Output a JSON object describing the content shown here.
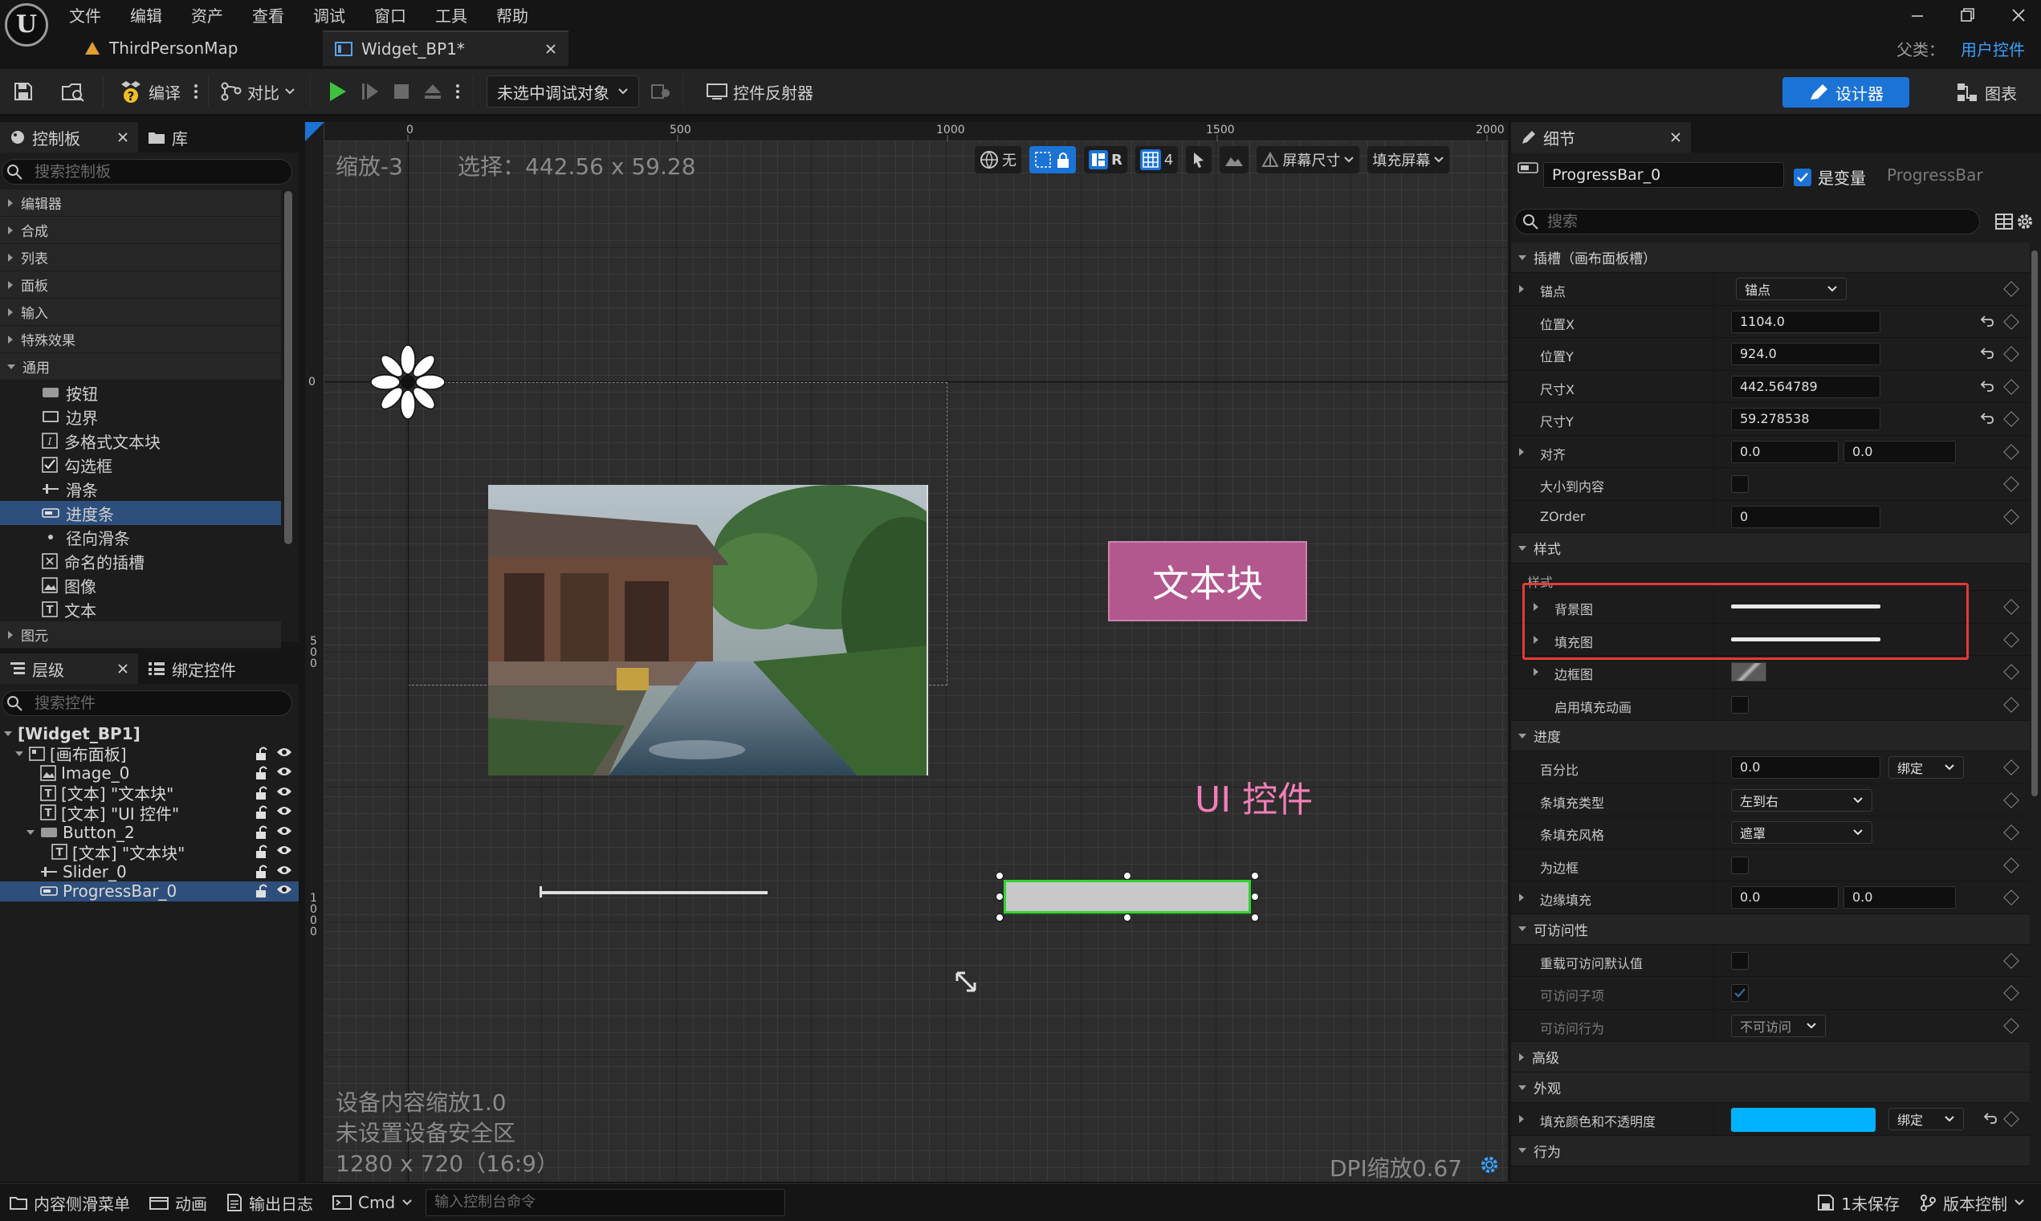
{
  "menu": {
    "logo": "U",
    "items": [
      "文件",
      "编辑",
      "资产",
      "查看",
      "调试",
      "窗口",
      "工具",
      "帮助"
    ]
  },
  "doc_tabs": [
    {
      "label": "ThirdPersonMap"
    },
    {
      "label": "Widget_BP1*"
    }
  ],
  "parent": {
    "label": "父类：",
    "value": "用户控件"
  },
  "toolbar": {
    "compile": "编译",
    "diff": "对比",
    "debug_target": "未选中调试对象",
    "reflector": "控件反射器",
    "designer": "设计器",
    "graph": "图表"
  },
  "palette": {
    "tabs": [
      "控制板",
      "库"
    ],
    "search_placeholder": "搜索控制板",
    "categories": [
      "编辑器",
      "合成",
      "列表",
      "面板",
      "输入",
      "特殊效果",
      "通用"
    ],
    "items": [
      "按钮",
      "边界",
      "多格式文本块",
      "勾选框",
      "滑条",
      "进度条",
      "径向滑条",
      "命名的插槽",
      "图像",
      "文本"
    ],
    "selected_item": "进度条",
    "bottom_category": "图元"
  },
  "hierarchy": {
    "tabs": [
      "层级",
      "绑定控件"
    ],
    "search_placeholder": "搜索控件",
    "items": [
      {
        "label": "[Widget_BP1]",
        "indent": 0,
        "icon": "none",
        "bold": true,
        "expanded": true
      },
      {
        "label": "[画布面板]",
        "indent": 1,
        "icon": "canvas",
        "expanded": true
      },
      {
        "label": "Image_0",
        "indent": 2,
        "icon": "image"
      },
      {
        "label": "[文本] \"文本块\"",
        "indent": 2,
        "icon": "text"
      },
      {
        "label": "[文本] \"UI 控件\"",
        "indent": 2,
        "icon": "text"
      },
      {
        "label": "Button_2",
        "indent": 2,
        "icon": "button",
        "expanded": true
      },
      {
        "label": "[文本] \"文本块\"",
        "indent": 3,
        "icon": "text"
      },
      {
        "label": "Slider_0",
        "indent": 2,
        "icon": "slider"
      },
      {
        "label": "ProgressBar_0",
        "indent": 2,
        "icon": "progress",
        "selected": true
      }
    ]
  },
  "canvas": {
    "zoom": "缩放-3",
    "selection": "选择：442.56 x 59.28",
    "ruler_top": [
      "0",
      "500",
      "1000",
      "1500",
      "2000"
    ],
    "ruler_left": [
      "0",
      "5\n0\n0",
      "1\n0\n0\n0"
    ],
    "tb_none": "无",
    "tb_r": "R",
    "tb_grid": "4",
    "tb_screen_size": "屏幕尺寸",
    "tb_fill_screen": "填充屏幕",
    "textblock": "文本块",
    "ui_label": "UI 控件",
    "device_scale": "设备内容缩放1.0",
    "safe_zone": "未设置设备安全区",
    "resolution": "1280 x 720（16:9）",
    "dpi": "DPI缩放0.67"
  },
  "details": {
    "tab": "细节",
    "name": "ProgressBar_0",
    "is_variable": "是变量",
    "class": "ProgressBar",
    "search_placeholder": "搜索",
    "rows": [
      {
        "type": "section",
        "label": "插槽（画布面板槽）"
      },
      {
        "type": "select",
        "label": "锚点",
        "value": "锚点",
        "arrow": true
      },
      {
        "type": "input",
        "label": "位置X",
        "value": "1104.0",
        "reset": true
      },
      {
        "type": "input",
        "label": "位置Y",
        "value": "924.0",
        "reset": true
      },
      {
        "type": "input",
        "label": "尺寸X",
        "value": "442.564789",
        "reset": true
      },
      {
        "type": "input",
        "label": "尺寸Y",
        "value": "59.278538",
        "reset": true
      },
      {
        "type": "pair",
        "label": "对齐",
        "v1": "0.0",
        "v2": "0.0",
        "arrow": true
      },
      {
        "type": "check",
        "label": "大小到内容"
      },
      {
        "type": "input",
        "label": "ZOrder",
        "value": "0"
      },
      {
        "type": "section",
        "label": "样式"
      },
      {
        "type": "subsection",
        "label": "样式"
      },
      {
        "type": "brush",
        "label": "背景图",
        "arrow": true
      },
      {
        "type": "brush",
        "label": "填充图",
        "arrow": true
      },
      {
        "type": "swatch",
        "label": "边框图",
        "arrow": true
      },
      {
        "type": "check",
        "label": "启用填充动画",
        "sub": true
      },
      {
        "type": "section",
        "label": "进度"
      },
      {
        "type": "bind",
        "label": "百分比",
        "value": "0.0",
        "bind": "绑定"
      },
      {
        "type": "selectw",
        "label": "条填充类型",
        "value": "左到右"
      },
      {
        "type": "selectw",
        "label": "条填充风格",
        "value": "遮罩"
      },
      {
        "type": "check",
        "label": "为边框"
      },
      {
        "type": "pair",
        "label": "边缘填充",
        "v1": "0.0",
        "v2": "0.0",
        "arrow": true
      },
      {
        "type": "section",
        "label": "可访问性"
      },
      {
        "type": "check",
        "label": "重载可访问默认值"
      },
      {
        "type": "checked",
        "label": "可访问子项",
        "dim": true
      },
      {
        "type": "selectdim",
        "label": "可访问行为",
        "value": "不可访问",
        "dim": true
      },
      {
        "type": "section",
        "label": "高级",
        "collapsed": true
      },
      {
        "type": "section",
        "label": "外观"
      },
      {
        "type": "color",
        "label": "填充颜色和不透明度",
        "bind": "绑定",
        "arrow": true
      },
      {
        "type": "section",
        "label": "行为"
      }
    ]
  },
  "statusbar": {
    "content_drawer": "内容侧滑菜单",
    "animation": "动画",
    "output_log": "输出日志",
    "cmd": "Cmd",
    "console_placeholder": "输入控制台命令",
    "unsaved": "1未保存",
    "source_control": "版本控制"
  },
  "colors": {
    "accent": "#1b73d6",
    "selection": "#2e4f7c",
    "highlight_box": "#e53935",
    "fill_color": "#00b2ff",
    "textblock_bg": "#b3588f",
    "ui_label": "#f27eb6",
    "progress_outline": "#2fd62f"
  }
}
